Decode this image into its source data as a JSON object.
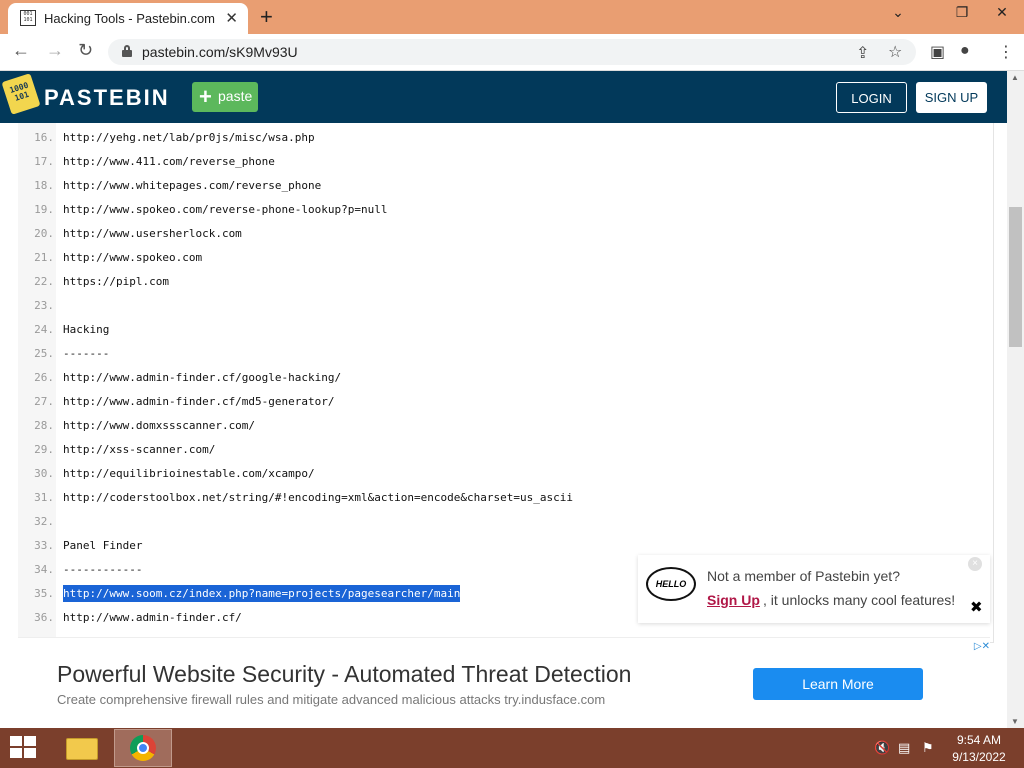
{
  "browser": {
    "tab_title": "Hacking Tools - Pastebin.com",
    "tab_close": "✕",
    "new_tab": "+",
    "url": "pastebin.com/sK9Mv93U",
    "window_controls": {
      "minimize": "⌄",
      "restore": "❐",
      "close": "✕"
    }
  },
  "pastebin": {
    "brand": "PASTEBIN",
    "logo_text": "1000 101",
    "paste_label": "paste",
    "login_label": "LOGIN",
    "signup_label": "SIGN UP"
  },
  "code_lines": [
    {
      "num": "16.",
      "text": "http://yehg.net/lab/pr0js/misc/wsa.php"
    },
    {
      "num": "17.",
      "text": "http://www.411.com/reverse_phone"
    },
    {
      "num": "18.",
      "text": "http://www.whitepages.com/reverse_phone"
    },
    {
      "num": "19.",
      "text": "http://www.spokeo.com/reverse-phone-lookup?p=null"
    },
    {
      "num": "20.",
      "text": "http://www.usersherlock.com"
    },
    {
      "num": "21.",
      "text": "http://www.spokeo.com"
    },
    {
      "num": "22.",
      "text": "https://pipl.com"
    },
    {
      "num": "23.",
      "text": ""
    },
    {
      "num": "24.",
      "text": "Hacking"
    },
    {
      "num": "25.",
      "text": "-------"
    },
    {
      "num": "26.",
      "text": "http://www.admin-finder.cf/google-hacking/"
    },
    {
      "num": "27.",
      "text": "http://www.admin-finder.cf/md5-generator/"
    },
    {
      "num": "28.",
      "text": "http://www.domxssscanner.com/"
    },
    {
      "num": "29.",
      "text": "http://xss-scanner.com/"
    },
    {
      "num": "30.",
      "text": "http://equilibrioinestable.com/xcampo/"
    },
    {
      "num": "31.",
      "text": "http://coderstoolbox.net/string/#!encoding=xml&action=encode&charset=us_ascii"
    },
    {
      "num": "32.",
      "text": ""
    },
    {
      "num": "33.",
      "text": "Panel Finder"
    },
    {
      "num": "34.",
      "text": "------------"
    },
    {
      "num": "35.",
      "text": "http://www.soom.cz/index.php?name=projects/pagesearcher/main"
    },
    {
      "num": "36.",
      "text": "http://www.admin-finder.cf/"
    }
  ],
  "popup": {
    "hello": "HELLO",
    "line1": "Not a member of Pastebin yet?",
    "signup_link": "Sign Up",
    "line2": ", it unlocks many cool features!",
    "close": "✖",
    "dismiss": "×"
  },
  "ad": {
    "headline": "Powerful Website Security - Automated Threat Detection",
    "description": "Create comprehensive firewall rules and mitigate advanced malicious attacks try.indusface.com",
    "cta": "Learn More",
    "choices": "▷✕"
  },
  "taskbar": {
    "time": "9:54 AM",
    "date": "9/13/2022"
  }
}
